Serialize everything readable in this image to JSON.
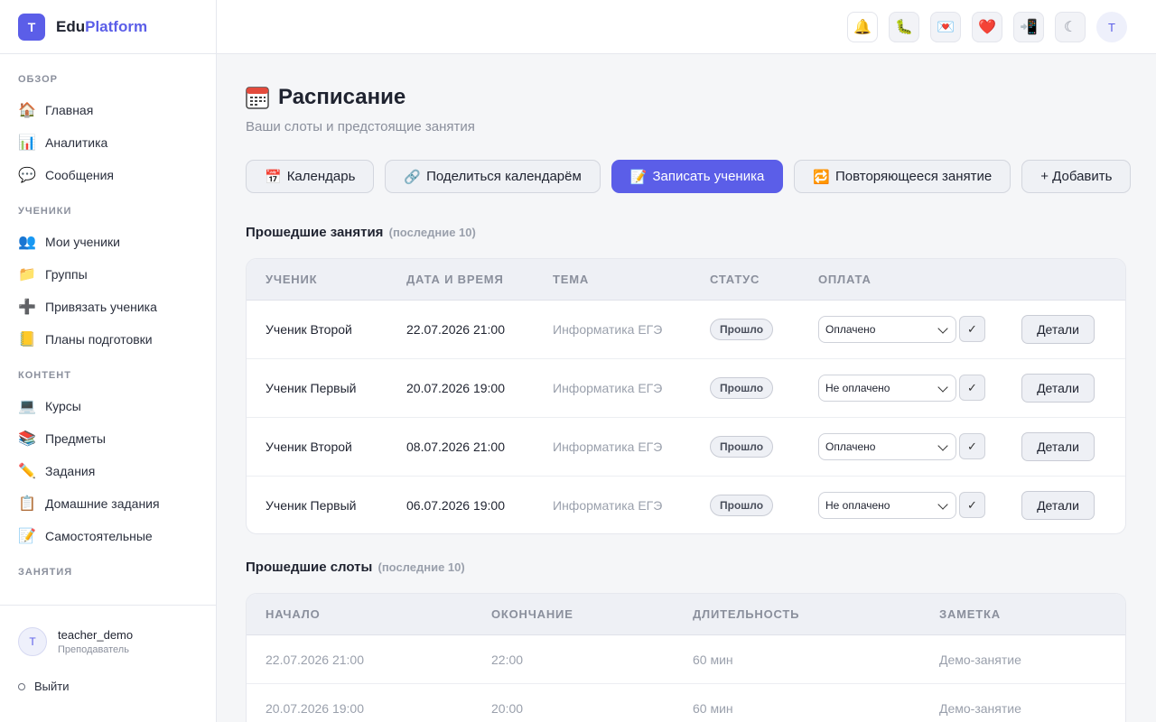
{
  "brand": {
    "logo_letter": "T",
    "name_part1": "Edu",
    "name_part2": "Platform",
    "accent": "#5b5ee8"
  },
  "sidebar": {
    "sections": [
      {
        "title": "ОБЗОР",
        "items": [
          {
            "label": "Главная",
            "icon": "home-icon"
          },
          {
            "label": "Аналитика",
            "icon": "chart-icon"
          },
          {
            "label": "Сообщения",
            "icon": "chat-icon"
          }
        ]
      },
      {
        "title": "УЧЕНИКИ",
        "items": [
          {
            "label": "Мои ученики",
            "icon": "students-icon"
          },
          {
            "label": "Группы",
            "icon": "folder-icon"
          },
          {
            "label": "Привязать ученика",
            "icon": "plus-icon"
          },
          {
            "label": "Планы подготовки",
            "icon": "plan-icon"
          }
        ]
      },
      {
        "title": "КОНТЕНТ",
        "items": [
          {
            "label": "Курсы",
            "icon": "laptop-icon"
          },
          {
            "label": "Предметы",
            "icon": "books-icon"
          },
          {
            "label": "Задания",
            "icon": "pencil-icon"
          },
          {
            "label": "Домашние задания",
            "icon": "clipboard-icon"
          },
          {
            "label": "Самостоятельные",
            "icon": "memo-icon"
          }
        ]
      },
      {
        "title": "ЗАНЯТИЯ",
        "items": []
      }
    ],
    "user": {
      "avatar_letter": "T",
      "name": "teacher_demo",
      "role": "Преподаватель"
    },
    "logout_label": "Выйти"
  },
  "topbar": {
    "icons": [
      "bell-icon",
      "bug-icon",
      "mail-icon",
      "heart-icon",
      "mobile-icon",
      "moon-icon"
    ],
    "avatar_letter": "T"
  },
  "page": {
    "title": "Расписание",
    "subtitle": "Ваши слоты и предстоящие занятия",
    "actions": [
      {
        "label": "Календарь",
        "icon": "calendar-icon",
        "primary": false
      },
      {
        "label": "Поделиться календарём",
        "icon": "link-icon",
        "primary": false
      },
      {
        "label": "Записать ученика",
        "icon": "memo-icon",
        "primary": true
      },
      {
        "label": "Повторяющееся занятие",
        "icon": "repeat-icon",
        "primary": false
      },
      {
        "label": "+ Добавить",
        "icon": "",
        "primary": false
      }
    ]
  },
  "past_lessons": {
    "title": "Прошедшие занятия",
    "note": "(последние 10)",
    "columns": [
      "УЧЕНИК",
      "ДАТА И ВРЕМЯ",
      "ТЕМА",
      "СТАТУС",
      "ОПЛАТА"
    ],
    "details_label": "Детали",
    "confirm_label": "✓",
    "rows": [
      {
        "student": "Ученик Второй",
        "datetime": "22.07.2026 21:00",
        "topic": "Информатика ЕГЭ",
        "status": "Прошло",
        "payment": "Оплачено"
      },
      {
        "student": "Ученик Первый",
        "datetime": "20.07.2026 19:00",
        "topic": "Информатика ЕГЭ",
        "status": "Прошло",
        "payment": "Не оплачено"
      },
      {
        "student": "Ученик Второй",
        "datetime": "08.07.2026 21:00",
        "topic": "Информатика ЕГЭ",
        "status": "Прошло",
        "payment": "Оплачено"
      },
      {
        "student": "Ученик Первый",
        "datetime": "06.07.2026 19:00",
        "topic": "Информатика ЕГЭ",
        "status": "Прошло",
        "payment": "Не оплачено"
      }
    ]
  },
  "past_slots": {
    "title": "Прошедшие слоты",
    "note": "(последние 10)",
    "columns": [
      "НАЧАЛО",
      "ОКОНЧАНИЕ",
      "ДЛИТЕЛЬНОСТЬ",
      "ЗАМЕТКА"
    ],
    "rows": [
      {
        "start": "22.07.2026 21:00",
        "end": "22:00",
        "duration": "60 мин",
        "note": "Демо-занятие"
      },
      {
        "start": "20.07.2026 19:00",
        "end": "20:00",
        "duration": "60 мин",
        "note": "Демо-занятие"
      }
    ]
  }
}
